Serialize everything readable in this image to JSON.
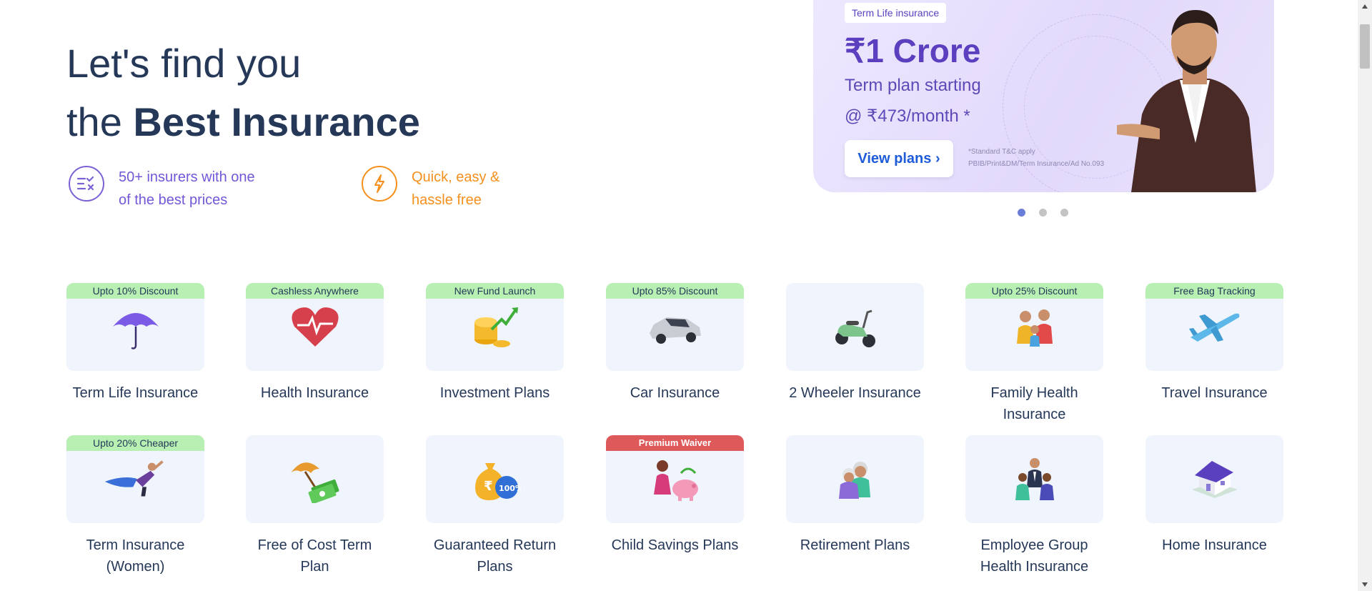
{
  "hero": {
    "line1": "Let's find you",
    "line2_prefix": "the ",
    "line2_bold": "Best Insurance"
  },
  "features": [
    {
      "icon": "compare-list-icon",
      "line1": "50+ insurers with one",
      "line2": "of the best prices",
      "color": "#7357d8"
    },
    {
      "icon": "lightning-icon",
      "line1": "Quick, easy &",
      "line2": "hassle free",
      "color": "#f5901d"
    }
  ],
  "banner": {
    "tag": "Term Life insurance",
    "price": "₹1 Crore",
    "subtitle1": "Term plan starting",
    "subtitle2": "@ ₹473/month *",
    "cta": "View plans ›",
    "fine1": "*Standard T&C apply",
    "fine2": "PBIB/Print&DM/Term Insurance/Ad No.093",
    "accent": "#5b3fbf"
  },
  "carousel": {
    "total": 3,
    "active": 1
  },
  "products": [
    {
      "name": "Term Life Insurance",
      "badge": "Upto 10% Discount",
      "icon": "umbrella-icon"
    },
    {
      "name": "Health Insurance",
      "badge": "Cashless Anywhere",
      "icon": "heart-pulse-icon"
    },
    {
      "name": "Investment Plans",
      "badge": "New Fund Launch",
      "icon": "coins-growth-icon"
    },
    {
      "name": "Car Insurance",
      "badge": "Upto 85% Discount",
      "icon": "car-icon"
    },
    {
      "name": "2 Wheeler Insurance",
      "badge": "",
      "icon": "scooter-icon"
    },
    {
      "name": "Family Health Insurance",
      "badge": "Upto 25% Discount",
      "icon": "family-icon"
    },
    {
      "name": "Travel Insurance",
      "badge": "Free Bag Tracking",
      "icon": "airplane-icon"
    },
    {
      "name": "Term Insurance (Women)",
      "badge": "Upto 20% Cheaper",
      "icon": "superwoman-icon"
    },
    {
      "name": "Free of Cost Term Plan",
      "badge": "",
      "icon": "umbrella-cash-icon"
    },
    {
      "name": "Guaranteed Return Plans",
      "badge": "",
      "icon": "money-bag-icon"
    },
    {
      "name": "Child Savings Plans",
      "badge": "Premium Waiver",
      "icon": "piggy-bank-icon"
    },
    {
      "name": "Retirement Plans",
      "badge": "",
      "icon": "elderly-couple-icon"
    },
    {
      "name": "Employee Group Health Insurance",
      "badge": "",
      "icon": "employees-icon"
    },
    {
      "name": "Home Insurance",
      "badge": "",
      "icon": "house-icon"
    }
  ],
  "colors": {
    "badge_green": "#b7f0b2",
    "badge_red": "#de5a5a",
    "card_bg": "#eff4fd",
    "text": "#253858"
  }
}
